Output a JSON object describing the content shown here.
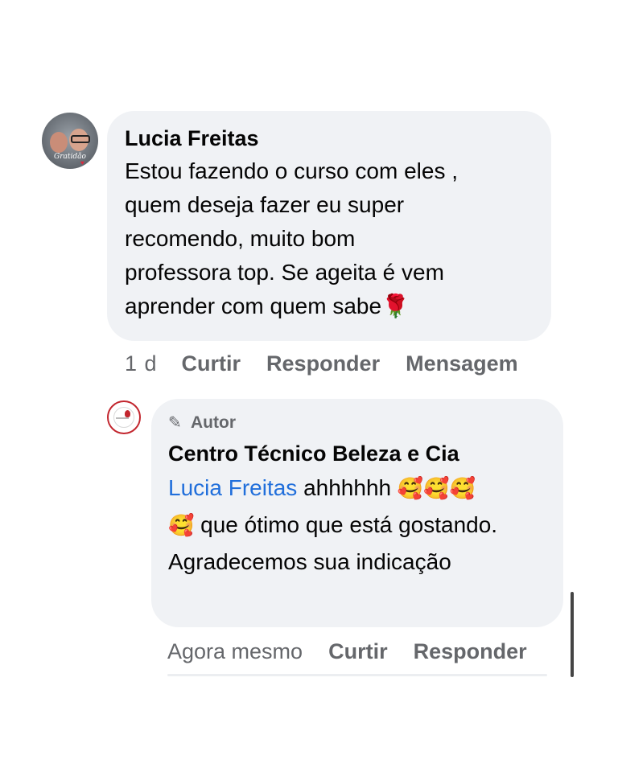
{
  "comment": {
    "author": "Lucia Freitas",
    "avatar_caption": "Gratidão",
    "text": "Estou fazendo o curso com eles ,\nquem deseja fazer eu super\nrecomendo,  muito bom\nprofessora top. Se ageita é vem\naprender com quem sabe🌹",
    "time": "1 d",
    "actions": {
      "like": "Curtir",
      "reply": "Responder",
      "message": "Mensagem"
    }
  },
  "reply": {
    "badge": "Autor",
    "badge_icon": "pencil-icon",
    "author": "Centro Técnico Beleza e Cia",
    "mention": "Lucia Freitas",
    "text_line1": " ahhhhhh ",
    "emoji_row": "🥰🥰🥰",
    "emoji_single": "🥰",
    "text_rest": " que ótimo que está gostando. Agradecemos sua indicação",
    "time": "Agora mesmo",
    "actions": {
      "like": "Curtir",
      "reply": "Responder"
    }
  },
  "colors": {
    "bubble": "#f0f2f5",
    "secondary_text": "#65676b",
    "mention": "#216fdb",
    "brand_red": "#c2262e"
  }
}
